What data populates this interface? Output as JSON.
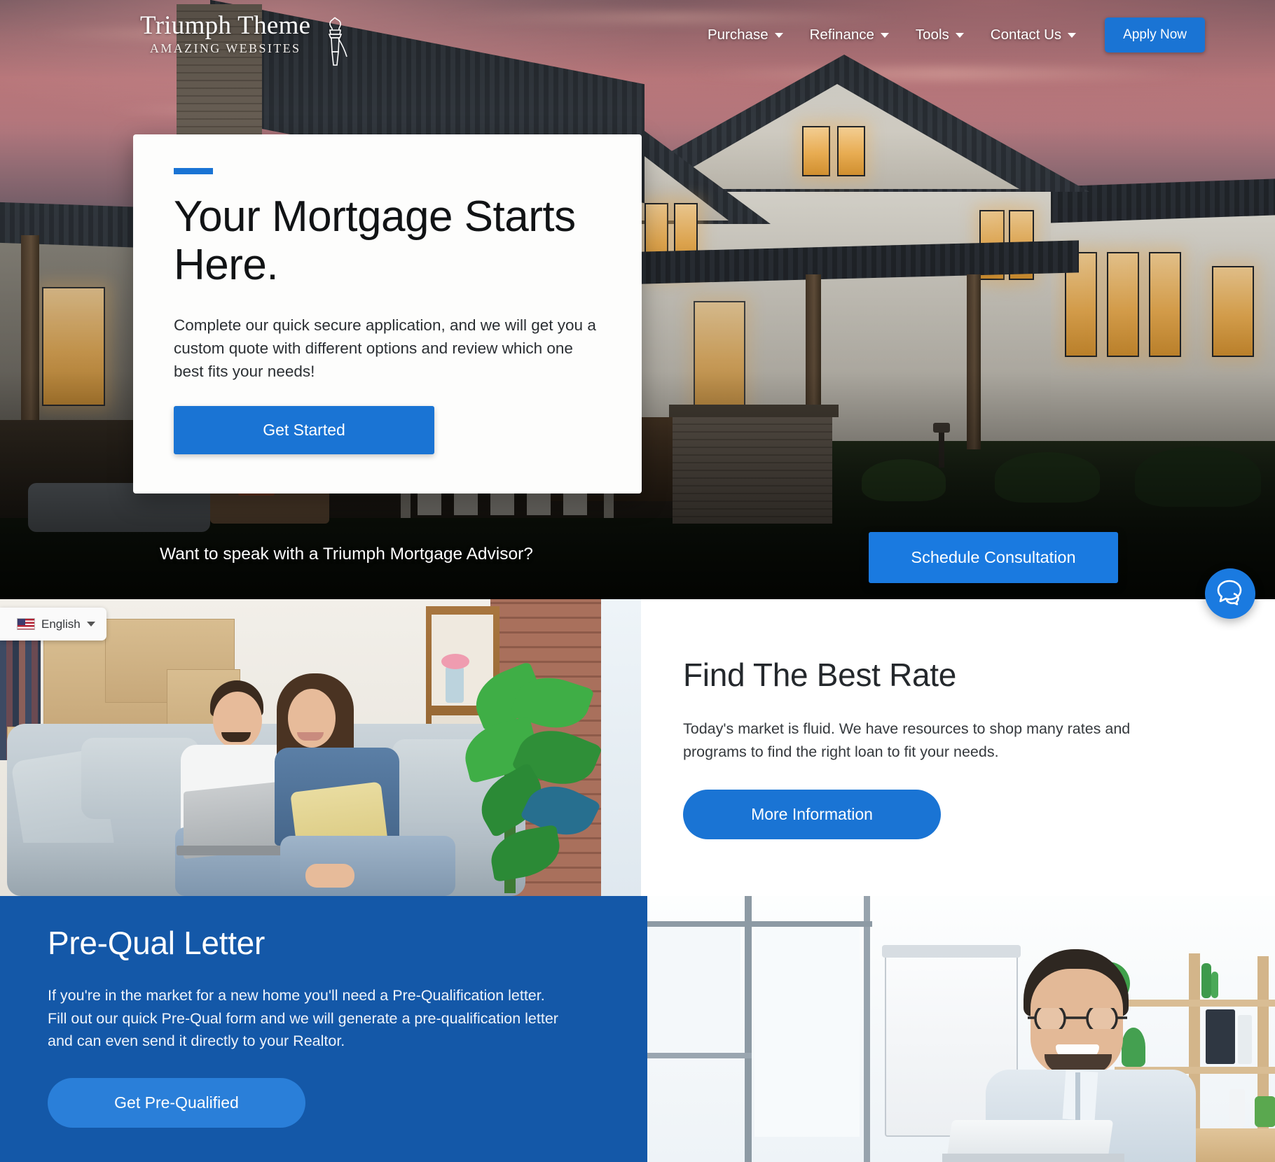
{
  "brand": {
    "name": "Triumph Theme",
    "tagline": "AMAZING WEBSITES",
    "logo_icon": "torch-icon"
  },
  "colors": {
    "accent_blue": "#1a74d4",
    "button_blue": "#1a7ae0",
    "section_blue": "#1458a8",
    "text_dark": "#24282c"
  },
  "nav": {
    "items": [
      {
        "label": "Purchase",
        "has_dropdown": true
      },
      {
        "label": "Refinance",
        "has_dropdown": true
      },
      {
        "label": "Tools",
        "has_dropdown": true
      },
      {
        "label": "Contact Us",
        "has_dropdown": true
      }
    ],
    "cta_label": "Apply Now"
  },
  "hero": {
    "title": "Your Mortgage Starts Here.",
    "subtitle": "Complete our quick secure application, and we will get you a custom quote with different options and review which one best fits your needs!",
    "cta_label": "Get Started",
    "advisor_prompt": "Want to speak with a Triumph Mortgage Advisor?",
    "schedule_label": "Schedule Consultation"
  },
  "language_selector": {
    "label": "English",
    "flag_icon": "us-flag-icon",
    "caret_icon": "chevron-down-icon"
  },
  "chat_widget": {
    "icon": "chat-bubbles-icon"
  },
  "sections": [
    {
      "id": "find-the-best-rate",
      "heading": "Find The Best Rate",
      "body": "Today's market is fluid. We have resources to shop many rates and programs to find the right loan to fit your needs.",
      "button_label": "More Information",
      "image_alt": "Couple sitting on a grey couch with a laptop surrounded by moving boxes"
    },
    {
      "id": "pre-qual-letter",
      "heading": "Pre-Qual Letter",
      "body": "If you're in the market for a new home you'll need a Pre-Qualification letter. Fill out our quick Pre-Qual form and we will generate a pre-qualification letter and can even send it directly to your Realtor.",
      "button_label": "Get Pre-Qualified",
      "image_alt": "Smiling man with glasses working on a laptop in a bright office"
    }
  ]
}
